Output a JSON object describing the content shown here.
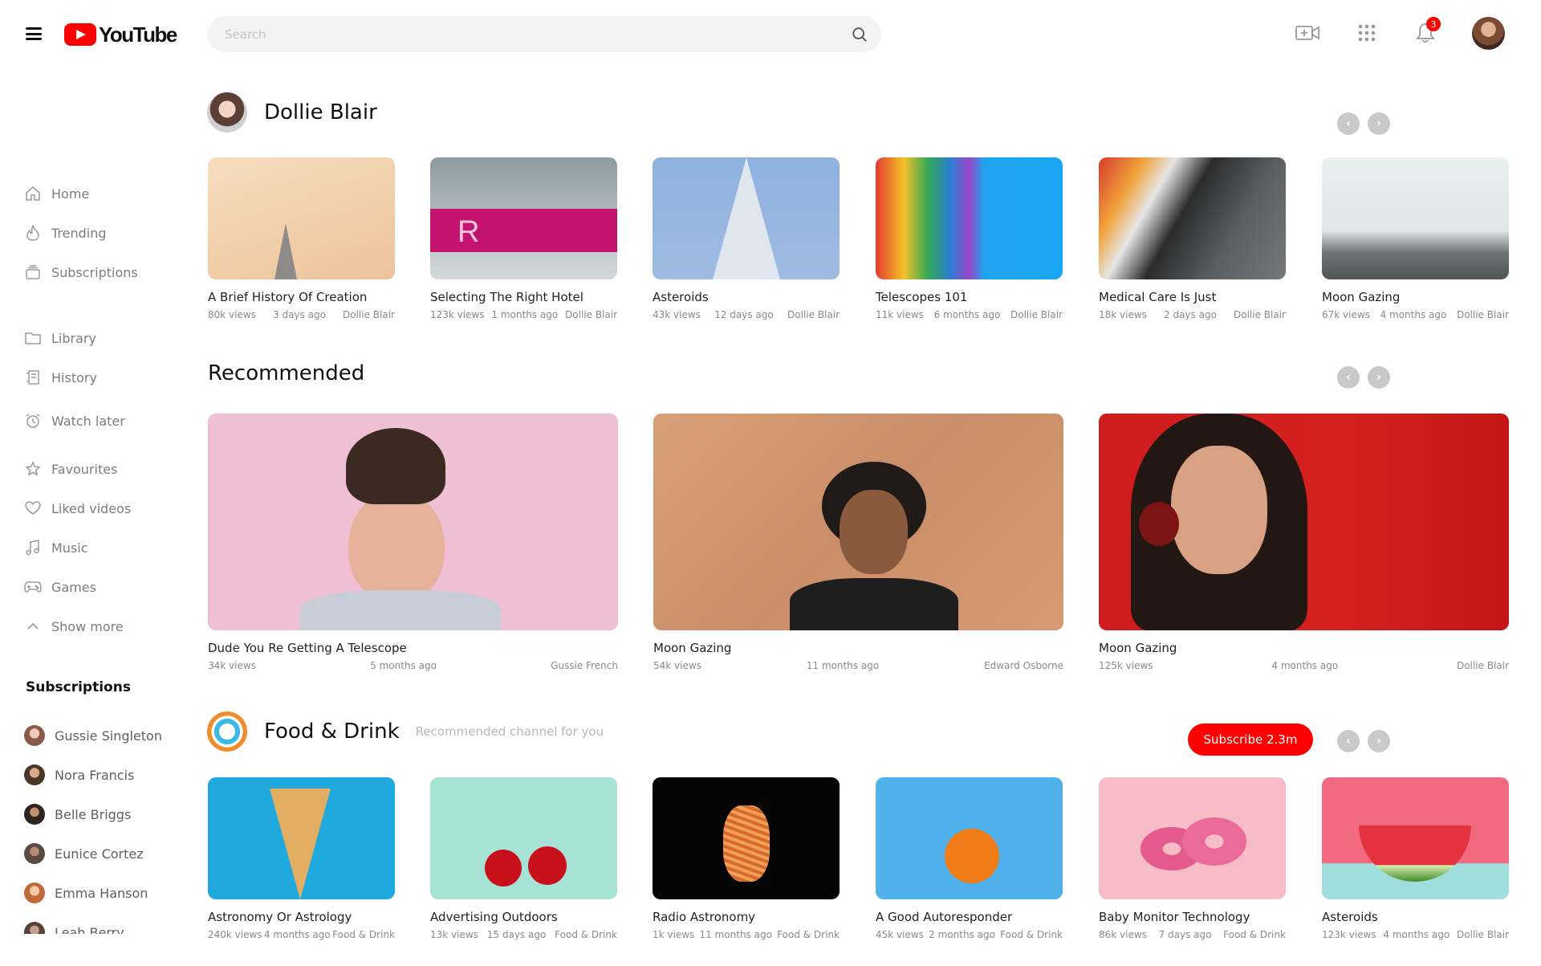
{
  "header": {
    "logo_text": "YouTube",
    "search_placeholder": "Search",
    "notification_count": "3",
    "icons": [
      "menu-icon",
      "youtube-play-icon",
      "search-icon",
      "video-camera-icon",
      "apps-grid-icon",
      "bell-icon"
    ]
  },
  "colors": {
    "brand": "#ff0000",
    "text": "#111111",
    "muted": "#8a8a8a",
    "nav_button": "#c9c9c9"
  },
  "sidebar": {
    "items": [
      {
        "label": "Home",
        "icon": "home-icon"
      },
      {
        "label": "Trending",
        "icon": "flame-icon"
      },
      {
        "label": "Subscriptions",
        "icon": "subscriptions-icon"
      },
      {
        "label": "Library",
        "icon": "folder-icon"
      },
      {
        "label": "History",
        "icon": "history-icon"
      },
      {
        "label": "Watch later",
        "icon": "alarm-clock-icon"
      },
      {
        "label": "Favourites",
        "icon": "star-icon"
      },
      {
        "label": "Liked videos",
        "icon": "heart-icon"
      },
      {
        "label": "Music",
        "icon": "music-note-icon"
      },
      {
        "label": "Games",
        "icon": "gamepad-icon"
      },
      {
        "label": "Show more",
        "icon": "chevron-up-icon"
      }
    ],
    "subscriptions_heading": "Subscriptions",
    "subscriptions": [
      {
        "name": "Gussie Singleton"
      },
      {
        "name": "Nora Francis"
      },
      {
        "name": "Belle Briggs"
      },
      {
        "name": "Eunice Cortez"
      },
      {
        "name": "Emma Hanson"
      },
      {
        "name": "Leah Berry"
      }
    ]
  },
  "channel_section": {
    "title": "Dollie Blair",
    "videos": [
      {
        "title": "A Brief History Of Creation",
        "views": "80k views",
        "age": "3 days ago",
        "channel": "Dollie Blair"
      },
      {
        "title": "Selecting The Right Hotel",
        "views": "123k views",
        "age": "1 months ago",
        "channel": "Dollie Blair"
      },
      {
        "title": "Asteroids",
        "views": "43k views",
        "age": "12 days ago",
        "channel": "Dollie Blair"
      },
      {
        "title": "Telescopes 101",
        "views": "11k views",
        "age": "6 months ago",
        "channel": "Dollie Blair"
      },
      {
        "title": "Medical Care Is Just",
        "views": "18k views",
        "age": "2 days ago",
        "channel": "Dollie Blair"
      },
      {
        "title": "Moon Gazing",
        "views": "67k views",
        "age": "4 months ago",
        "channel": "Dollie Blair"
      }
    ]
  },
  "recommended_section": {
    "title": "Recommended",
    "videos": [
      {
        "title": "Dude You Re Getting A Telescope",
        "views": "34k views",
        "age": "5 months ago",
        "channel": "Gussie French"
      },
      {
        "title": "Moon Gazing",
        "views": "54k views",
        "age": "11 months ago",
        "channel": "Edward Osborne"
      },
      {
        "title": "Moon Gazing",
        "views": "125k views",
        "age": "4 months ago",
        "channel": "Dollie Blair"
      }
    ]
  },
  "food_section": {
    "title": "Food & Drink",
    "subtitle": "Recommended channel for you",
    "subscribe_label": "Subscribe 2.3m",
    "videos": [
      {
        "title": "Astronomy Or Astrology",
        "views": "240k views",
        "age": "4 months ago",
        "channel": "Food & Drink"
      },
      {
        "title": "Advertising Outdoors",
        "views": "13k views",
        "age": "15 days ago",
        "channel": "Food & Drink"
      },
      {
        "title": "Radio Astronomy",
        "views": "1k views",
        "age": "11 months ago",
        "channel": "Food & Drink"
      },
      {
        "title": "A Good Autoresponder",
        "views": "45k views",
        "age": "2 months ago",
        "channel": "Food & Drink"
      },
      {
        "title": "Baby Monitor Technology",
        "views": "86k views",
        "age": "7 days ago",
        "channel": "Food & Drink"
      },
      {
        "title": "Asteroids",
        "views": "123k views",
        "age": "4 months ago",
        "channel": "Dollie Blair"
      }
    ]
  }
}
